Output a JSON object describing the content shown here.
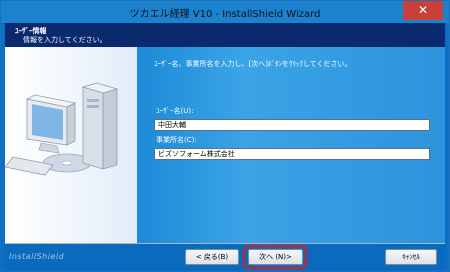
{
  "window": {
    "title": "ツカエル経理 V10 - InstallShield Wizard",
    "close_glyph": "✕"
  },
  "header": {
    "title": "ﾕｰｻﾞｰ情報",
    "subtitle": "情報を入力してください。"
  },
  "main": {
    "instruction": "ﾕｰｻﾞｰ名、事業所名を入力し、[次へ]ﾎﾞﾀﾝをｸﾘｯｸしてください。",
    "user_name_label": "ﾕｰｻﾞｰ名(U):",
    "user_name_value": "中田大輔",
    "company_label": "事業所名(C):",
    "company_value": "ビズソフォーム株式会社"
  },
  "footer": {
    "brand": "InstallShield",
    "back_label": "< 戻る(B)",
    "next_label": "次へ (N)>",
    "cancel_label": "ｷｬﾝｾﾙ"
  },
  "colors": {
    "title_bar": "#1a82cf",
    "header_band": "#0a2a6d",
    "panel_blue": "#2d93dd",
    "highlight_red": "#e0191f"
  }
}
